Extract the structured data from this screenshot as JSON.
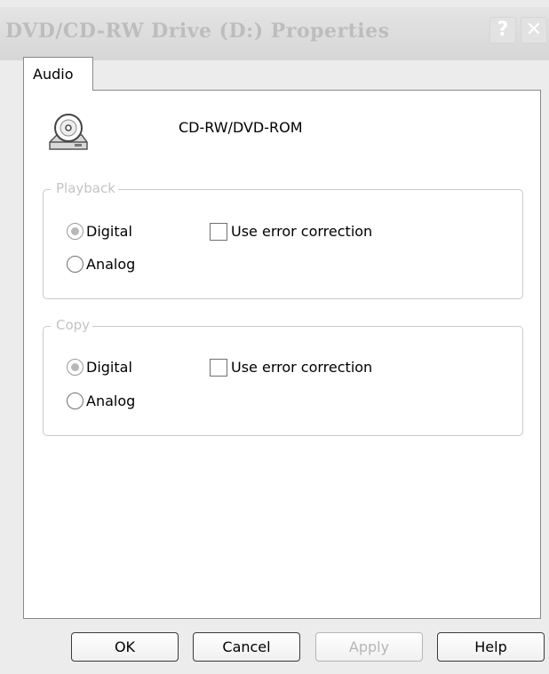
{
  "window": {
    "title": "DVD/CD-RW Drive (D:) Properties",
    "help_glyph": "?",
    "close_glyph": "✕"
  },
  "tabs": [
    {
      "label": "Audio",
      "selected": true
    }
  ],
  "device": {
    "icon": "cd-drive-icon",
    "name": "CD-RW/DVD-ROM"
  },
  "playback": {
    "legend": "Playback",
    "digital_label": "Digital",
    "analog_label": "Analog",
    "error_correction_label": "Use error correction",
    "selected": "Digital",
    "error_correction_checked": false
  },
  "copy": {
    "legend": "Copy",
    "digital_label": "Digital",
    "analog_label": "Analog",
    "error_correction_label": "Use error correction",
    "selected": "Digital",
    "error_correction_checked": false
  },
  "buttons": {
    "ok": "OK",
    "cancel": "Cancel",
    "apply": "Apply",
    "help": "Help"
  },
  "colors": {
    "panel": "#ffffff",
    "dialog": "#ececec",
    "disabled_text": "#b5b5b5",
    "legend_text": "#c4c4c4"
  }
}
